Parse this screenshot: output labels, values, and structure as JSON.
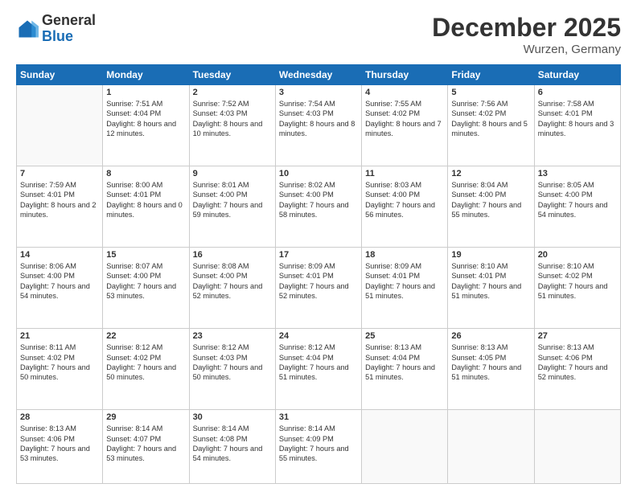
{
  "header": {
    "logo_general": "General",
    "logo_blue": "Blue",
    "month_title": "December 2025",
    "location": "Wurzen, Germany"
  },
  "weekdays": [
    "Sunday",
    "Monday",
    "Tuesday",
    "Wednesday",
    "Thursday",
    "Friday",
    "Saturday"
  ],
  "weeks": [
    [
      {
        "day": "",
        "sunrise": "",
        "sunset": "",
        "daylight": ""
      },
      {
        "day": "1",
        "sunrise": "Sunrise: 7:51 AM",
        "sunset": "Sunset: 4:04 PM",
        "daylight": "Daylight: 8 hours and 12 minutes."
      },
      {
        "day": "2",
        "sunrise": "Sunrise: 7:52 AM",
        "sunset": "Sunset: 4:03 PM",
        "daylight": "Daylight: 8 hours and 10 minutes."
      },
      {
        "day": "3",
        "sunrise": "Sunrise: 7:54 AM",
        "sunset": "Sunset: 4:03 PM",
        "daylight": "Daylight: 8 hours and 8 minutes."
      },
      {
        "day": "4",
        "sunrise": "Sunrise: 7:55 AM",
        "sunset": "Sunset: 4:02 PM",
        "daylight": "Daylight: 8 hours and 7 minutes."
      },
      {
        "day": "5",
        "sunrise": "Sunrise: 7:56 AM",
        "sunset": "Sunset: 4:02 PM",
        "daylight": "Daylight: 8 hours and 5 minutes."
      },
      {
        "day": "6",
        "sunrise": "Sunrise: 7:58 AM",
        "sunset": "Sunset: 4:01 PM",
        "daylight": "Daylight: 8 hours and 3 minutes."
      }
    ],
    [
      {
        "day": "7",
        "sunrise": "Sunrise: 7:59 AM",
        "sunset": "Sunset: 4:01 PM",
        "daylight": "Daylight: 8 hours and 2 minutes."
      },
      {
        "day": "8",
        "sunrise": "Sunrise: 8:00 AM",
        "sunset": "Sunset: 4:01 PM",
        "daylight": "Daylight: 8 hours and 0 minutes."
      },
      {
        "day": "9",
        "sunrise": "Sunrise: 8:01 AM",
        "sunset": "Sunset: 4:00 PM",
        "daylight": "Daylight: 7 hours and 59 minutes."
      },
      {
        "day": "10",
        "sunrise": "Sunrise: 8:02 AM",
        "sunset": "Sunset: 4:00 PM",
        "daylight": "Daylight: 7 hours and 58 minutes."
      },
      {
        "day": "11",
        "sunrise": "Sunrise: 8:03 AM",
        "sunset": "Sunset: 4:00 PM",
        "daylight": "Daylight: 7 hours and 56 minutes."
      },
      {
        "day": "12",
        "sunrise": "Sunrise: 8:04 AM",
        "sunset": "Sunset: 4:00 PM",
        "daylight": "Daylight: 7 hours and 55 minutes."
      },
      {
        "day": "13",
        "sunrise": "Sunrise: 8:05 AM",
        "sunset": "Sunset: 4:00 PM",
        "daylight": "Daylight: 7 hours and 54 minutes."
      }
    ],
    [
      {
        "day": "14",
        "sunrise": "Sunrise: 8:06 AM",
        "sunset": "Sunset: 4:00 PM",
        "daylight": "Daylight: 7 hours and 54 minutes."
      },
      {
        "day": "15",
        "sunrise": "Sunrise: 8:07 AM",
        "sunset": "Sunset: 4:00 PM",
        "daylight": "Daylight: 7 hours and 53 minutes."
      },
      {
        "day": "16",
        "sunrise": "Sunrise: 8:08 AM",
        "sunset": "Sunset: 4:00 PM",
        "daylight": "Daylight: 7 hours and 52 minutes."
      },
      {
        "day": "17",
        "sunrise": "Sunrise: 8:09 AM",
        "sunset": "Sunset: 4:01 PM",
        "daylight": "Daylight: 7 hours and 52 minutes."
      },
      {
        "day": "18",
        "sunrise": "Sunrise: 8:09 AM",
        "sunset": "Sunset: 4:01 PM",
        "daylight": "Daylight: 7 hours and 51 minutes."
      },
      {
        "day": "19",
        "sunrise": "Sunrise: 8:10 AM",
        "sunset": "Sunset: 4:01 PM",
        "daylight": "Daylight: 7 hours and 51 minutes."
      },
      {
        "day": "20",
        "sunrise": "Sunrise: 8:10 AM",
        "sunset": "Sunset: 4:02 PM",
        "daylight": "Daylight: 7 hours and 51 minutes."
      }
    ],
    [
      {
        "day": "21",
        "sunrise": "Sunrise: 8:11 AM",
        "sunset": "Sunset: 4:02 PM",
        "daylight": "Daylight: 7 hours and 50 minutes."
      },
      {
        "day": "22",
        "sunrise": "Sunrise: 8:12 AM",
        "sunset": "Sunset: 4:02 PM",
        "daylight": "Daylight: 7 hours and 50 minutes."
      },
      {
        "day": "23",
        "sunrise": "Sunrise: 8:12 AM",
        "sunset": "Sunset: 4:03 PM",
        "daylight": "Daylight: 7 hours and 50 minutes."
      },
      {
        "day": "24",
        "sunrise": "Sunrise: 8:12 AM",
        "sunset": "Sunset: 4:04 PM",
        "daylight": "Daylight: 7 hours and 51 minutes."
      },
      {
        "day": "25",
        "sunrise": "Sunrise: 8:13 AM",
        "sunset": "Sunset: 4:04 PM",
        "daylight": "Daylight: 7 hours and 51 minutes."
      },
      {
        "day": "26",
        "sunrise": "Sunrise: 8:13 AM",
        "sunset": "Sunset: 4:05 PM",
        "daylight": "Daylight: 7 hours and 51 minutes."
      },
      {
        "day": "27",
        "sunrise": "Sunrise: 8:13 AM",
        "sunset": "Sunset: 4:06 PM",
        "daylight": "Daylight: 7 hours and 52 minutes."
      }
    ],
    [
      {
        "day": "28",
        "sunrise": "Sunrise: 8:13 AM",
        "sunset": "Sunset: 4:06 PM",
        "daylight": "Daylight: 7 hours and 53 minutes."
      },
      {
        "day": "29",
        "sunrise": "Sunrise: 8:14 AM",
        "sunset": "Sunset: 4:07 PM",
        "daylight": "Daylight: 7 hours and 53 minutes."
      },
      {
        "day": "30",
        "sunrise": "Sunrise: 8:14 AM",
        "sunset": "Sunset: 4:08 PM",
        "daylight": "Daylight: 7 hours and 54 minutes."
      },
      {
        "day": "31",
        "sunrise": "Sunrise: 8:14 AM",
        "sunset": "Sunset: 4:09 PM",
        "daylight": "Daylight: 7 hours and 55 minutes."
      },
      {
        "day": "",
        "sunrise": "",
        "sunset": "",
        "daylight": ""
      },
      {
        "day": "",
        "sunrise": "",
        "sunset": "",
        "daylight": ""
      },
      {
        "day": "",
        "sunrise": "",
        "sunset": "",
        "daylight": ""
      }
    ]
  ]
}
